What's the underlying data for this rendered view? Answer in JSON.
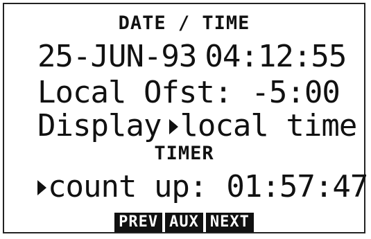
{
  "screen": {
    "datetime_heading": "DATE / TIME",
    "date": "25-JUN-93",
    "time": "04:12:55",
    "offset_label": "Local Ofst:",
    "offset_value": "-5:00",
    "display_label": "Display",
    "display_value": "local time",
    "timer_heading": "TIMER",
    "timer_label": "count up:",
    "timer_value": "01:57:47"
  },
  "softkeys": {
    "prev": "PREV",
    "aux": "AUX",
    "next": "NEXT"
  },
  "icons": {
    "selection_pointer": "right-triangle-pointer-icon"
  },
  "colors": {
    "foreground": "#111111",
    "background": "#ffffff"
  }
}
